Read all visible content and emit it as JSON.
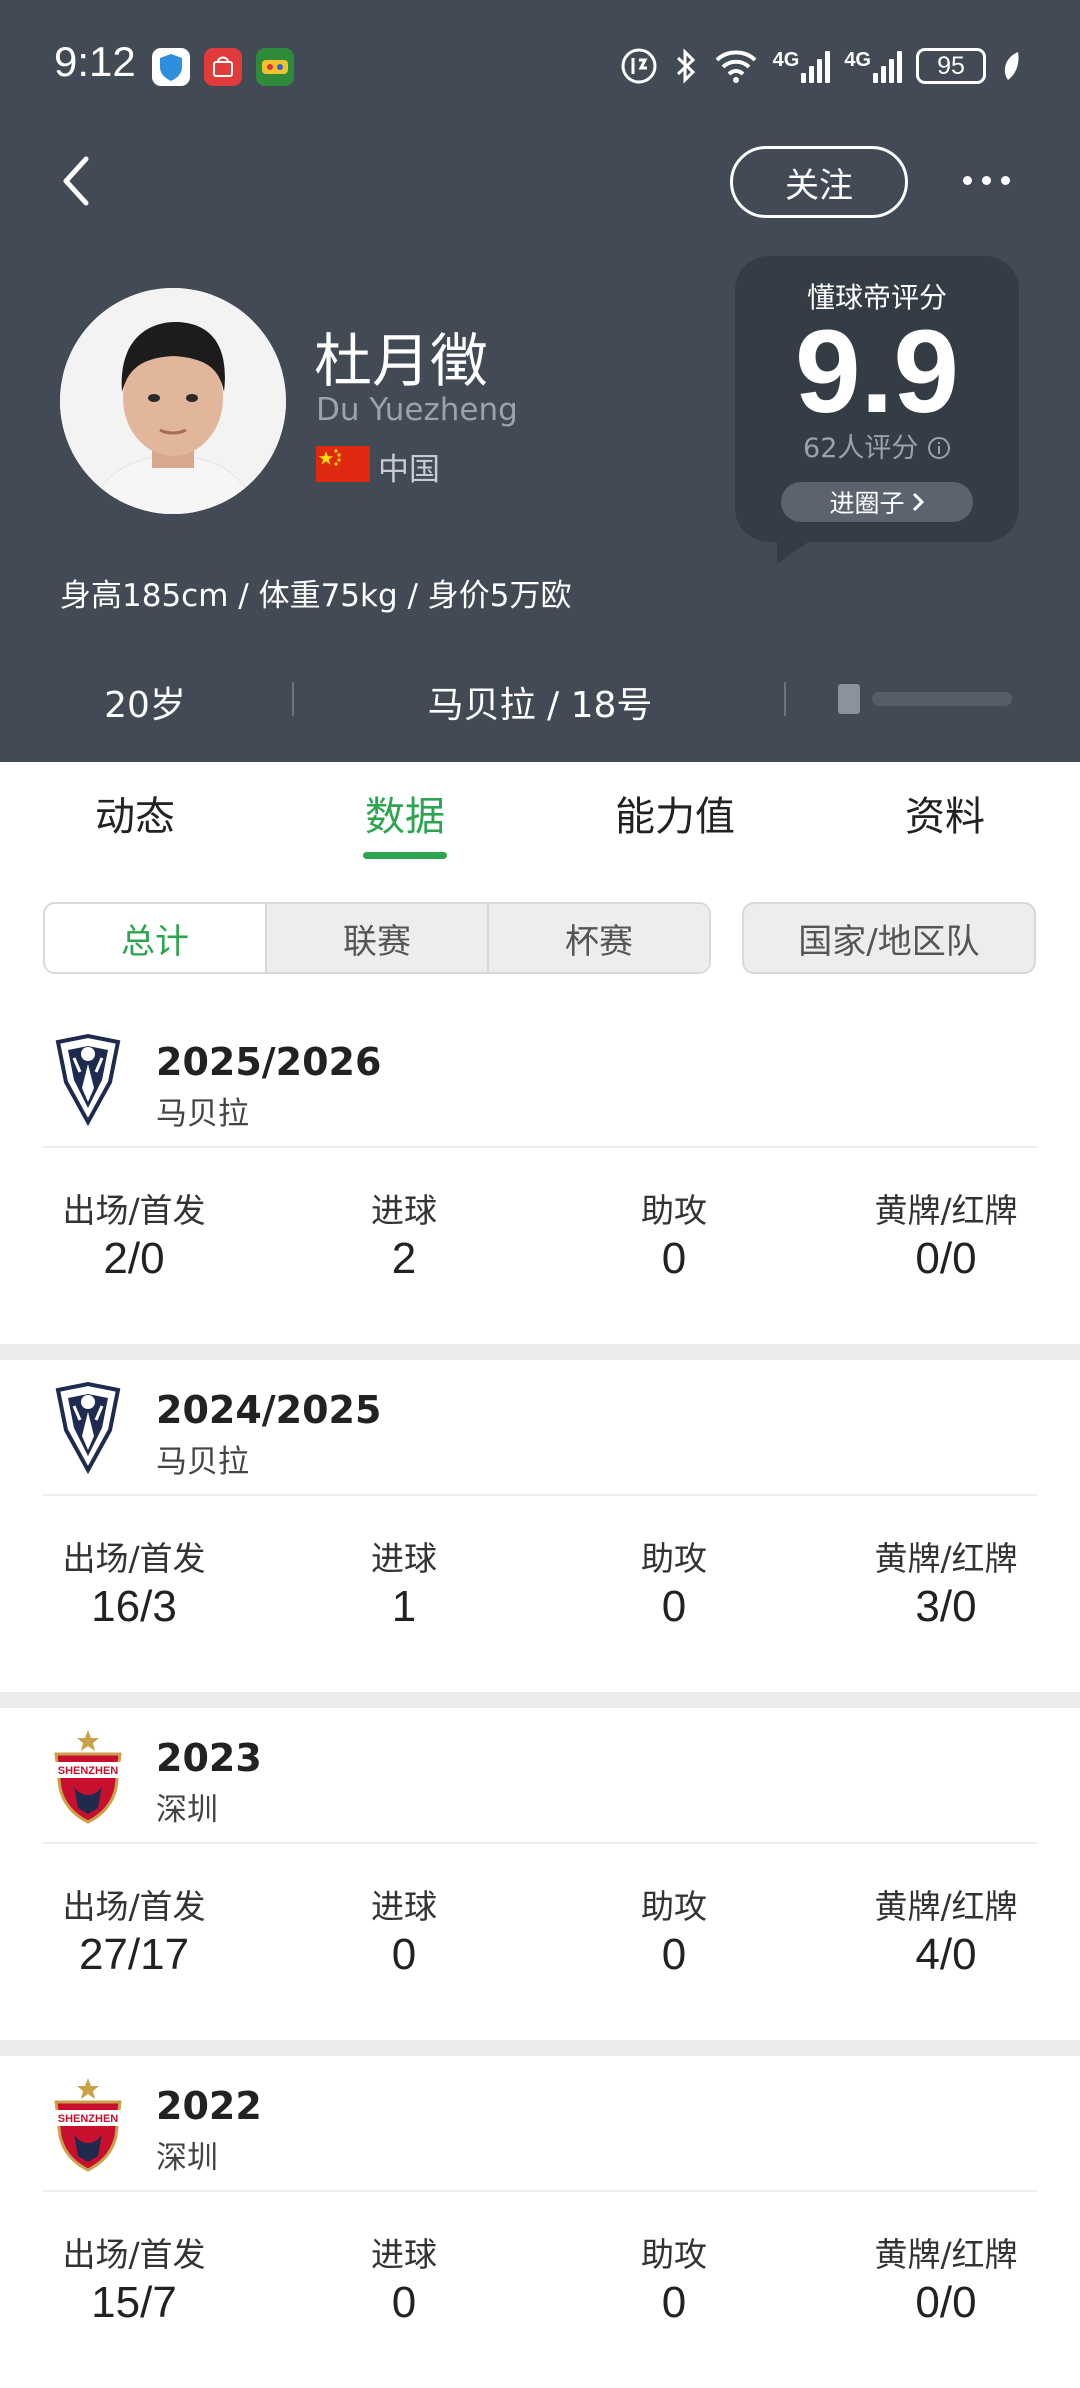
{
  "status_bar": {
    "time": "9:12",
    "network_1": "4G",
    "network_2": "4G",
    "battery": "95"
  },
  "header": {
    "follow_label": "关注",
    "player": {
      "name_cn": "杜月徵",
      "name_en": "Du Yuezheng",
      "country": "中国",
      "body_info": "身高185cm / 体重75kg / 身价5万欧"
    },
    "rating": {
      "title": "懂球帝评分",
      "score": "9.9",
      "count_label": "62人评分",
      "button_label": "进圈子"
    },
    "info_row": {
      "age": "20岁",
      "club_number": "马贝拉 / 18号"
    }
  },
  "tabs": [
    {
      "label": "动态"
    },
    {
      "label": "数据"
    },
    {
      "label": "能力值"
    },
    {
      "label": "资料"
    }
  ],
  "filters": {
    "segments": [
      {
        "label": "总计"
      },
      {
        "label": "联赛"
      },
      {
        "label": "杯赛"
      }
    ],
    "national": "国家/地区队"
  },
  "stat_labels": {
    "apps": "出场/首发",
    "goals": "进球",
    "assists": "助攻",
    "cards": "黄牌/红牌"
  },
  "seasons": [
    {
      "year": "2025/2026",
      "club": "马贝拉",
      "apps": "2/0",
      "goals": "2",
      "assists": "0",
      "cards": "0/0",
      "crest": "marbella-crest-icon"
    },
    {
      "year": "2024/2025",
      "club": "马贝拉",
      "apps": "16/3",
      "goals": "1",
      "assists": "0",
      "cards": "3/0",
      "crest": "marbella-crest-icon"
    },
    {
      "year": "2023",
      "club": "深圳",
      "apps": "27/17",
      "goals": "0",
      "assists": "0",
      "cards": "4/0",
      "crest": "shenzhen-crest-icon",
      "crest_text": "SHENZHEN"
    },
    {
      "year": "2022",
      "club": "深圳",
      "apps": "15/7",
      "goals": "0",
      "assists": "0",
      "cards": "0/0",
      "crest": "shenzhen-crest-icon",
      "crest_text": "SHENZHEN"
    }
  ],
  "colors": {
    "header_bg": "#414a55",
    "accent_green": "#2da44e",
    "rating_card": "#343c46"
  }
}
